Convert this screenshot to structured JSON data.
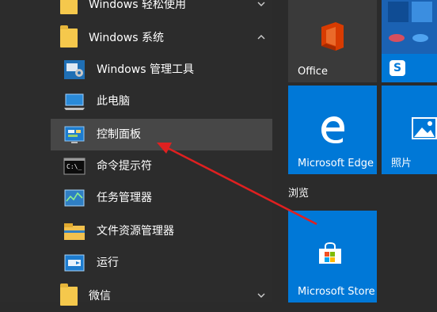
{
  "app_list": {
    "ease_of_access_folder": "Windows 轻松使用",
    "system_folder": "Windows 系统",
    "items": [
      {
        "label": "Windows 管理工具",
        "icon": "admin-tools-icon"
      },
      {
        "label": "此电脑",
        "icon": "this-pc-icon"
      },
      {
        "label": "控制面板",
        "icon": "control-panel-icon"
      },
      {
        "label": "命令提示符",
        "icon": "command-prompt-icon"
      },
      {
        "label": "任务管理器",
        "icon": "task-manager-icon"
      },
      {
        "label": "文件资源管理器",
        "icon": "file-explorer-icon"
      },
      {
        "label": "运行",
        "icon": "run-icon"
      }
    ],
    "next_folder": "微信"
  },
  "tiles": {
    "office": "Office",
    "edge": "Microsoft Edge",
    "photos": "照片",
    "browse_section": "浏览",
    "store": "Microsoft Store"
  },
  "colors": {
    "tile_blue": "#0078d7",
    "highlight": "#474747",
    "folder_yellow": "#f5c84c",
    "annotation_arrow": "#e02020"
  }
}
